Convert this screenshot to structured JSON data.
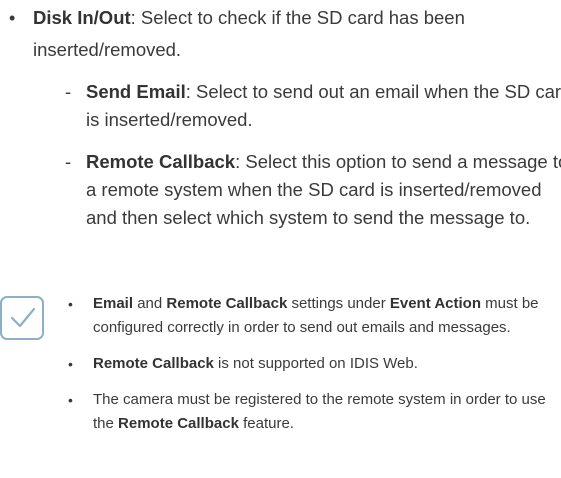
{
  "bullets": {
    "main": "•",
    "dash": "-",
    "note": "•"
  },
  "disk_item": {
    "label": "Disk In/Out",
    "text": ": Select to check if the SD card has been inserted/removed."
  },
  "sub_items": [
    {
      "label": "Send Email",
      "text": ": Select to send out an email when the SD card is inserted/removed."
    },
    {
      "label": "Remote Callback",
      "text": ": Select this option to send a message to a remote system when the SD card is inserted/removed and then select which system to send the message to."
    }
  ],
  "note": {
    "icon": "checkmark-icon",
    "icon_color": "#8bb0c8",
    "item1": {
      "b1": "Email",
      "t1": " and ",
      "b2": "Remote Callback",
      "t2": " settings under ",
      "b3": "Event Action",
      "t3": " must be configured correctly in order to send out emails and messages."
    },
    "item2": {
      "b1": "Remote Callback",
      "t1": " is not supported on IDIS Web."
    },
    "item3": {
      "t1": "The camera must be registered to the remote system in order to use the ",
      "b1": "Remote Callback",
      "t2": " feature."
    }
  }
}
